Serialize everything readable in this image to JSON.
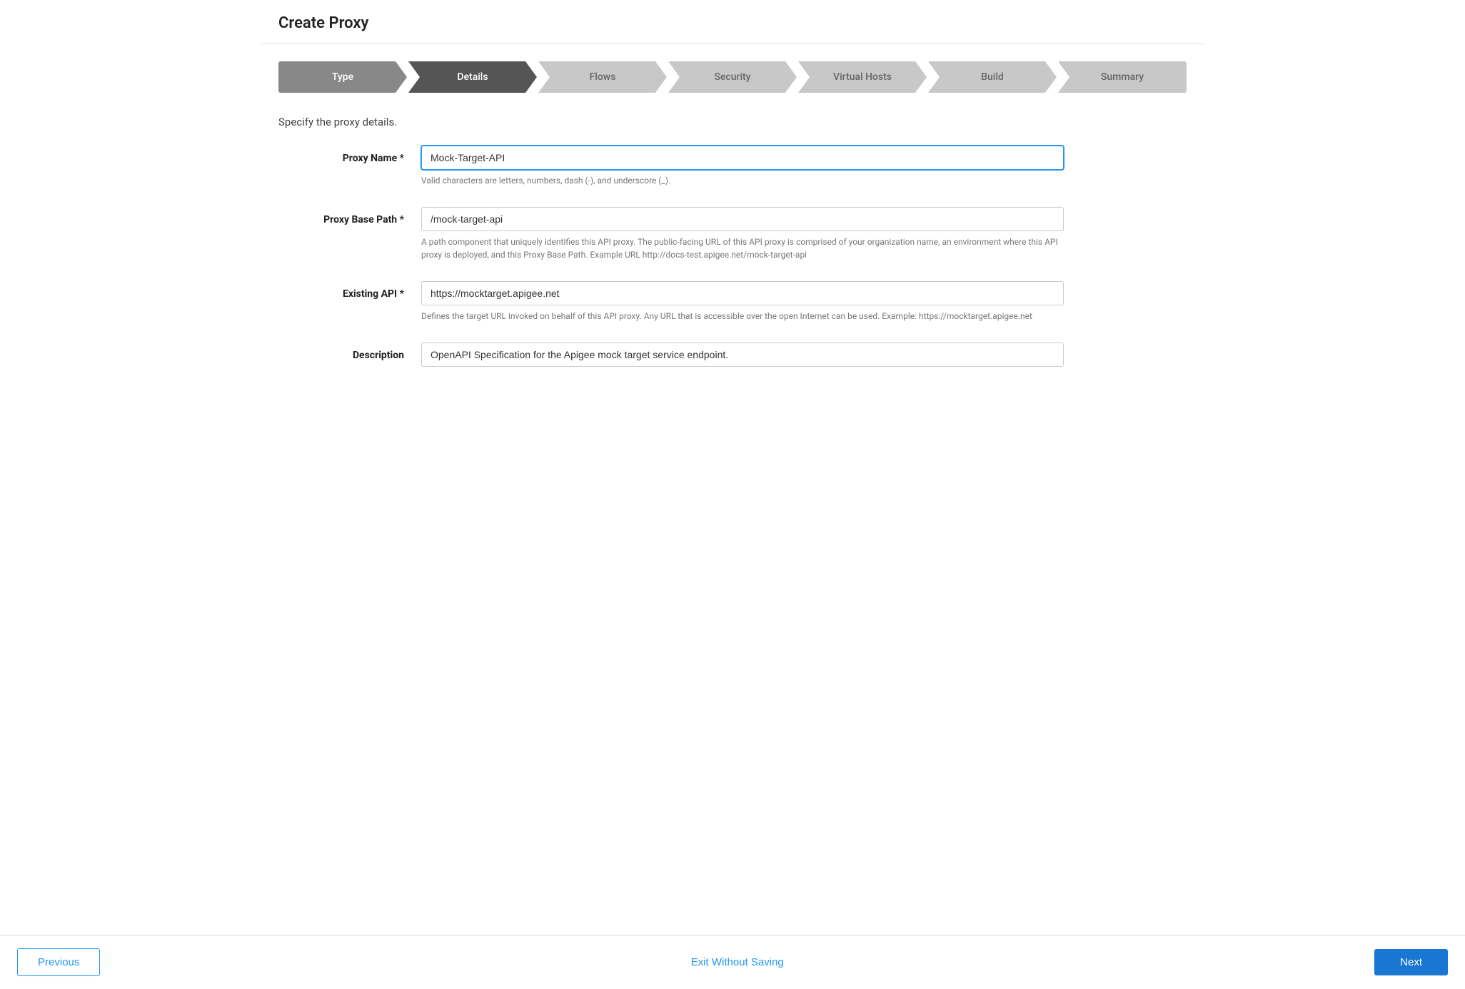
{
  "page": {
    "title": "Create Proxy"
  },
  "stepper": {
    "steps": [
      {
        "id": "type",
        "label": "Type",
        "state": "completed"
      },
      {
        "id": "details",
        "label": "Details",
        "state": "active"
      },
      {
        "id": "flows",
        "label": "Flows",
        "state": "inactive"
      },
      {
        "id": "security",
        "label": "Security",
        "state": "inactive"
      },
      {
        "id": "virtual-hosts",
        "label": "Virtual Hosts",
        "state": "inactive"
      },
      {
        "id": "build",
        "label": "Build",
        "state": "inactive"
      },
      {
        "id": "summary",
        "label": "Summary",
        "state": "inactive"
      }
    ]
  },
  "form": {
    "subtitle": "Specify the proxy details.",
    "proxy_name": {
      "label": "Proxy Name *",
      "value": "Mock-Target-API",
      "hint": "Valid characters are letters, numbers, dash (-), and underscore (_)."
    },
    "proxy_base_path": {
      "label": "Proxy Base Path *",
      "value": "/mock-target-api",
      "hint": "A path component that uniquely identifies this API proxy. The public-facing URL of this API proxy is comprised of your organization name, an environment where this API proxy is deployed, and this Proxy Base Path. Example URL http://docs-test.apigee.net/mock-target-api"
    },
    "existing_api": {
      "label": "Existing API *",
      "value": "https://mocktarget.apigee.net",
      "hint": "Defines the target URL invoked on behalf of this API proxy. Any URL that is accessible over the open Internet can be used. Example: https://mocktarget.apigee.net"
    },
    "description": {
      "label": "Description",
      "value": "OpenAPI Specification for the Apigee mock target service endpoint.",
      "hint": ""
    }
  },
  "footer": {
    "previous_label": "Previous",
    "exit_label": "Exit Without Saving",
    "next_label": "Next"
  }
}
